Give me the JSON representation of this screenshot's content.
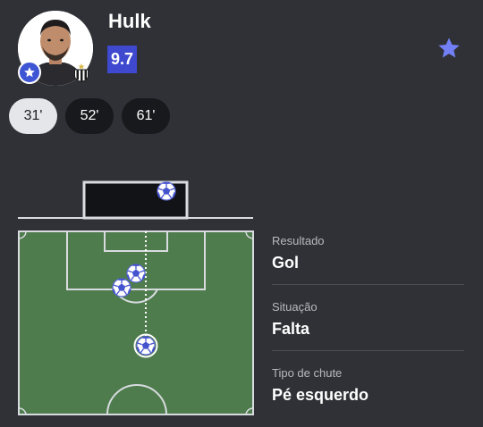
{
  "player": {
    "name": "Hulk",
    "rating": "9.7",
    "colors": {
      "rating_bg": "#3e49cf",
      "accent": "#7380f5"
    }
  },
  "icons": {
    "favorite": "star-icon",
    "badge": "star-badge-icon",
    "club": "club-crest-icon"
  },
  "shots": [
    {
      "label": "31'",
      "selected": true
    },
    {
      "label": "52'",
      "selected": false
    },
    {
      "label": "61'",
      "selected": false
    }
  ],
  "details": {
    "result": {
      "label": "Resultado",
      "value": "Gol"
    },
    "situation": {
      "label": "Situação",
      "value": "Falta"
    },
    "shot_type": {
      "label": "Tipo de chute",
      "value": "Pé esquerdo"
    }
  },
  "pitch_colors": {
    "grass": "#4e7c4c",
    "lines": "#d8dbe0",
    "goal": "#121316"
  }
}
